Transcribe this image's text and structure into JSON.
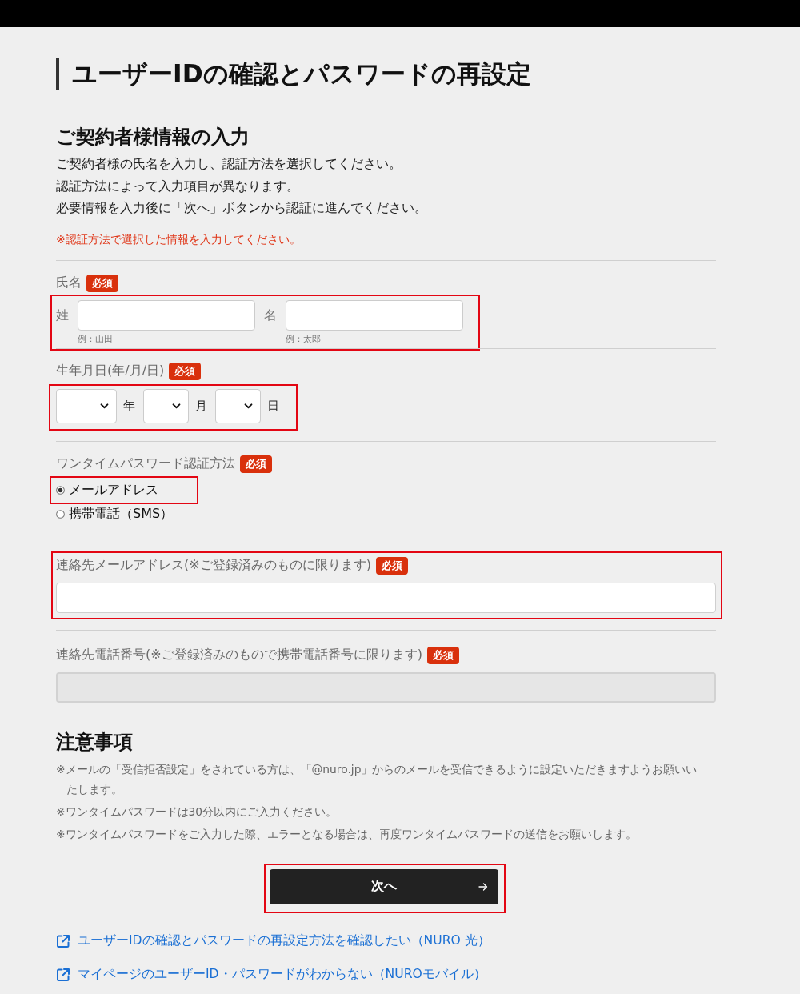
{
  "page": {
    "title": "ユーザーIDの確認とパスワードの再設定"
  },
  "contract_section": {
    "heading": "ご契約者様情報の入力",
    "intro": [
      "ご契約者様の氏名を入力し、認証方法を選択してください。",
      "認証方法によって入力項目が異なります。",
      "必要情報を入力後に「次へ」ボタンから認証に進んでください。"
    ],
    "note": "※認証方法で選択した情報を入力してください。"
  },
  "form": {
    "fields": [
      {
        "kind": "name",
        "label": "氏名",
        "badge": "必須",
        "highlighted": true,
        "parts": [
          {
            "label": "姓",
            "hint": "例：山田"
          },
          {
            "label": "名",
            "hint": "例：太郎"
          }
        ]
      },
      {
        "kind": "date",
        "label": "生年月日(年/月/日)",
        "badge": "必須",
        "highlighted": true,
        "parts": [
          {
            "unit": "年"
          },
          {
            "unit": "月"
          },
          {
            "unit": "日"
          }
        ]
      },
      {
        "kind": "radio",
        "label": "ワンタイムパスワード認証方法",
        "badge": "必須",
        "options": [
          {
            "label": "メールアドレス",
            "selected": true,
            "highlighted": true
          },
          {
            "label": "携帯電話（SMS）",
            "selected": false
          }
        ]
      },
      {
        "kind": "text",
        "label": "連絡先メールアドレス(※ご登録済みのものに限ります)",
        "badge": "必須",
        "highlighted": true,
        "disabled": false
      },
      {
        "kind": "text",
        "label": "連絡先電話番号(※ご登録済みのもので携帯電話番号に限ります)",
        "badge": "必須",
        "disabled": true
      }
    ]
  },
  "notes": {
    "heading": "注意事項",
    "items": [
      "※メールの「受信拒否設定」をされている方は、「@nuro.jp」からのメールを受信できるように設定いただきますようお願いいたします。",
      "※ワンタイムパスワードは30分以内にご入力ください。",
      "※ワンタイムパスワードをご入力した際、エラーとなる場合は、再度ワンタイムパスワードの送信をお願いします。"
    ]
  },
  "next_button": {
    "label": "次へ",
    "highlighted": true
  },
  "links": [
    "ユーザーIDの確認とパスワードの再設定方法を確認したい（NURO 光）",
    "マイページのユーザーID・パスワードがわからない（NUROモバイル）"
  ]
}
